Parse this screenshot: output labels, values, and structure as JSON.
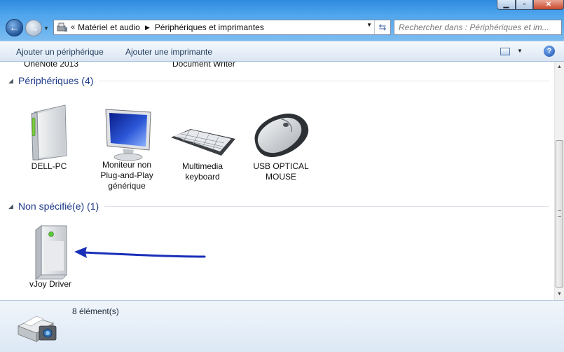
{
  "address": {
    "breadcrumb": [
      "Matériel et audio",
      "Périphériques et imprimantes"
    ],
    "sep": "«"
  },
  "search": {
    "placeholder": "Rechercher dans : Périphériques et im..."
  },
  "toolbar": {
    "add_device": "Ajouter un périphérique",
    "add_printer": "Ajouter une imprimante"
  },
  "truncated_items": [
    "OneNote 2013",
    "Document Writer"
  ],
  "groups": [
    {
      "title": "Périphériques (4)",
      "devices": [
        {
          "name": "DELL-PC",
          "icon": "computer-tower-icon"
        },
        {
          "name": "Moniteur non Plug-and-Play générique",
          "icon": "monitor-icon"
        },
        {
          "name": "Multimedia keyboard",
          "icon": "keyboard-icon"
        },
        {
          "name": "USB OPTICAL MOUSE",
          "icon": "mouse-icon"
        }
      ]
    },
    {
      "title": "Non spécifié(e) (1)",
      "devices": [
        {
          "name": "vJoy Driver",
          "icon": "generic-device-icon"
        }
      ]
    }
  ],
  "status": {
    "count": "8 élément(s)"
  },
  "colors": {
    "accent": "#1e3a8a",
    "arrow": "#1a2fb8",
    "titlebar": "#4ea4ec"
  }
}
